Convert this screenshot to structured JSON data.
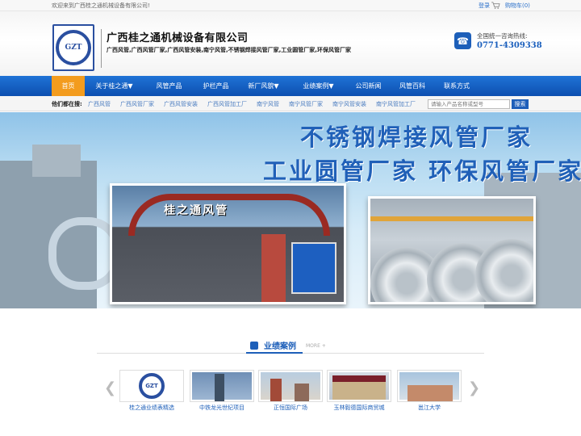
{
  "topbar": {
    "welcome": "欢迎来到广西桂之通机械设备有限公司!",
    "login": "登录",
    "cart": "购物车(0)"
  },
  "header": {
    "logo_text": "GZT",
    "company_name": "广西桂之通机械设备有限公司",
    "keywords": "广西风管,广西风管厂家,广西风管安装,南宁风管,不锈钢焊接风管厂家,工业圆管厂家,环保风管厂家",
    "hotline_label": "全国统一咨询热线:",
    "hotline": "0771-4309338"
  },
  "nav": {
    "items": [
      {
        "label": "首页",
        "active": true
      },
      {
        "label": "关于桂之通▼"
      },
      {
        "label": "风管产品"
      },
      {
        "label": "护栏产品"
      },
      {
        "label": "新厂风貌▼"
      },
      {
        "label": "业绩案例▼"
      },
      {
        "label": "公司新闻"
      },
      {
        "label": "风管百科"
      },
      {
        "label": "联系方式"
      }
    ]
  },
  "subbar": {
    "label": "他们都在搜:",
    "links": [
      "广西风管",
      "广西风管厂家",
      "广西风管安装",
      "广西风管加工厂",
      "南宁风管",
      "南宁风管厂家",
      "南宁风管安装",
      "南宁风管加工厂"
    ],
    "search_placeholder": "请输入产品名称或型号",
    "search_button": "搜索"
  },
  "banner": {
    "slogan_line1": "不锈钢焊接风管厂家",
    "slogan_line2": "工业圆管厂家  环保风管厂家",
    "sign_text": "桂之通风管"
  },
  "cases": {
    "title": "业绩案例",
    "more": "MORE +",
    "items": [
      {
        "label": "桂之通业绩表精选"
      },
      {
        "label": "中铁龙光世纪项目"
      },
      {
        "label": "正恒国际广场"
      },
      {
        "label": "玉林毅德国际商贸城"
      },
      {
        "label": "邕江大学"
      }
    ]
  },
  "colors": {
    "nav_blue": "#1565c8",
    "active_orange": "#f39c1e",
    "brand_blue": "#1d5fb9"
  }
}
